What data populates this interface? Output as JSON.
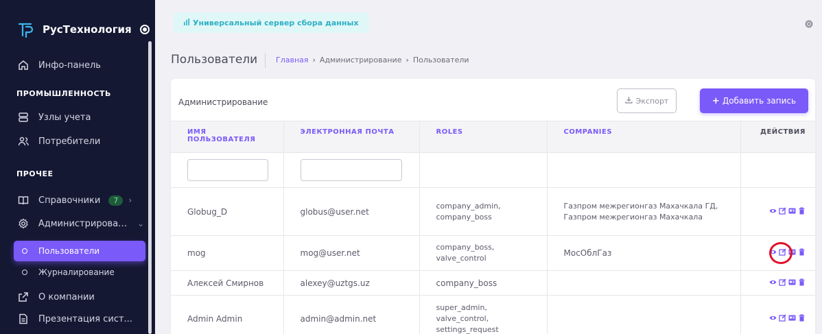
{
  "brand": {
    "name": "РусТехнология"
  },
  "sidebar": {
    "info_panel": "Инфо-панель",
    "section_industry": "ПРОМЫШЛЕННОСТЬ",
    "metering_nodes": "Узлы учета",
    "consumers": "Потребители",
    "section_other": "ПРОЧЕЕ",
    "directories": "Справочники",
    "directories_badge": "7",
    "administration": "Администрирован...",
    "users": "Пользователи",
    "logging": "Журналирование",
    "about": "О компании",
    "presentation": "Презентация сист..."
  },
  "header": {
    "server_pill": "Универсальный сервер сбора данных"
  },
  "page": {
    "title": "Пользователи"
  },
  "breadcrumb": {
    "home": "Главная",
    "admin": "Администрирование",
    "current": "Пользователи"
  },
  "card": {
    "title": "Администрирование",
    "export_label": "Экспорт",
    "add_label": "Добавить запись"
  },
  "table": {
    "headers": {
      "username": "ИМЯ ПОЛЬЗОВАТЕЛЯ",
      "email": "ЭЛЕКТРОННАЯ ПОЧТА",
      "roles": "ROLES",
      "companies": "COMPANIES",
      "actions": "ДЕЙСТВИЯ"
    },
    "rows": [
      {
        "username": "Globug_D",
        "email": "globus@user.net",
        "roles": "company_admin, company_boss",
        "companies": "Газпром межрегионгаз Махачкала ГД, Газпром межрегионгаз Махачкала"
      },
      {
        "username": "mog",
        "email": "mog@user.net",
        "roles": "company_boss, valve_control",
        "companies": "МосОблГаз"
      },
      {
        "username": "Алексей Смирнов",
        "email": "alexey@uztgs.uz",
        "roles": "company_boss",
        "companies": ""
      },
      {
        "username": "Admin Admin",
        "email": "admin@admin.net",
        "roles": "super_admin, valve_control, settings_request",
        "companies": ""
      }
    ]
  },
  "colors": {
    "sidebar_bg": "#141833",
    "accent": "#7a5af8",
    "pill_bg": "#e0f7f8",
    "pill_text": "#2fb0c4",
    "highlight": "#e0102a"
  },
  "icons": {
    "actions": [
      "eye-icon",
      "edit-icon",
      "id-card-icon",
      "trash-icon"
    ]
  }
}
